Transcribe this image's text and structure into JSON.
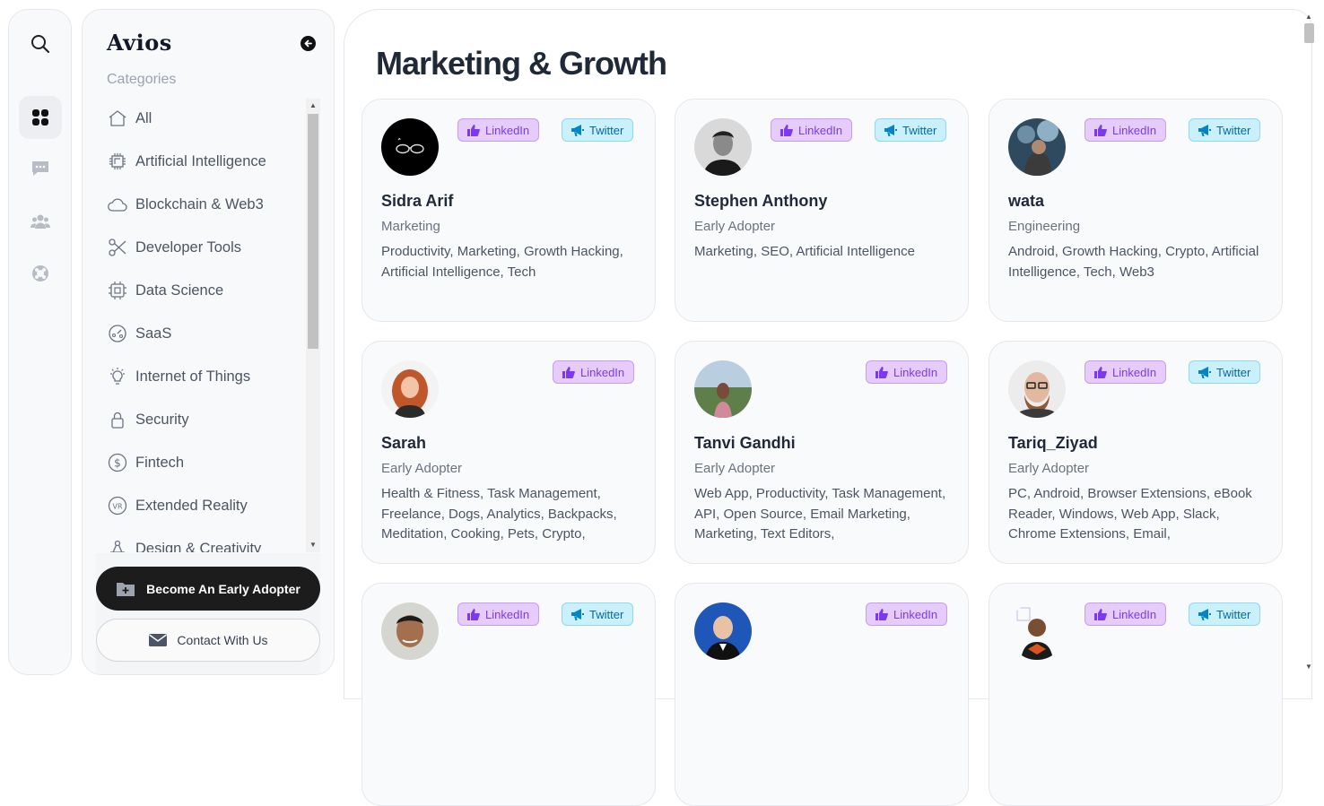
{
  "sidebar": {
    "brand": "Avios",
    "categories_heading": "Categories",
    "categories": [
      {
        "label": "All",
        "icon": "home-icon"
      },
      {
        "label": "Artificial Intelligence",
        "icon": "ai-chip-icon"
      },
      {
        "label": "Blockchain & Web3",
        "icon": "cloud-icon"
      },
      {
        "label": "Developer Tools",
        "icon": "scissors-icon"
      },
      {
        "label": "Data Science",
        "icon": "cpu-icon"
      },
      {
        "label": "SaaS",
        "icon": "dashboard-icon"
      },
      {
        "label": "Internet of Things",
        "icon": "lightbulb-icon"
      },
      {
        "label": "Security",
        "icon": "lock-icon"
      },
      {
        "label": "Fintech",
        "icon": "dollar-icon"
      },
      {
        "label": "Extended Reality",
        "icon": "vr-icon"
      },
      {
        "label": "Design & Creativity",
        "icon": "design-icon"
      }
    ],
    "early_adopter_button": "Become An Early Adopter",
    "contact_button": "Contact With Us"
  },
  "main": {
    "title": "Marketing & Growth",
    "people": [
      {
        "name": "Sidra Arif",
        "role": "Marketing",
        "tags": "Productivity, Marketing, Growth Hacking, Artificial Intelligence, Tech",
        "linkedin": "LinkedIn",
        "twitter": "Twitter"
      },
      {
        "name": "Stephen Anthony",
        "role": "Early Adopter",
        "tags": "Marketing, SEO, Artificial Intelligence",
        "linkedin": "LinkedIn",
        "twitter": "Twitter"
      },
      {
        "name": "wata",
        "role": "Engineering",
        "tags": "Android, Growth Hacking, Crypto, Artificial Intelligence, Tech, Web3",
        "linkedin": "LinkedIn",
        "twitter": "Twitter"
      },
      {
        "name": "Sarah",
        "role": "Early Adopter",
        "tags": "Health & Fitness, Task Management, Freelance, Dogs, Analytics, Backpacks, Meditation, Cooking, Pets, Crypto,",
        "linkedin": "LinkedIn"
      },
      {
        "name": "Tanvi Gandhi",
        "role": "Early Adopter",
        "tags": "Web App, Productivity, Task Management, API, Open Source, Email Marketing, Marketing, Text Editors,",
        "linkedin": "LinkedIn"
      },
      {
        "name": "Tariq_Ziyad",
        "role": "Early Adopter",
        "tags": "PC, Android, Browser Extensions, eBook Reader, Windows, Web App, Slack, Chrome Extensions, Email,",
        "linkedin": "LinkedIn",
        "twitter": "Twitter"
      },
      {
        "name": "",
        "role": "",
        "tags": "",
        "linkedin": "LinkedIn",
        "twitter": "Twitter"
      },
      {
        "name": "",
        "role": "",
        "tags": "",
        "linkedin": "LinkedIn"
      },
      {
        "name": "",
        "role": "",
        "tags": "",
        "linkedin": "LinkedIn",
        "twitter": "Twitter"
      }
    ]
  },
  "colors": {
    "linkedin_bg": "#e5ccfb",
    "twitter_bg": "#c9f0fb",
    "dark_button": "#1c1c1c"
  }
}
